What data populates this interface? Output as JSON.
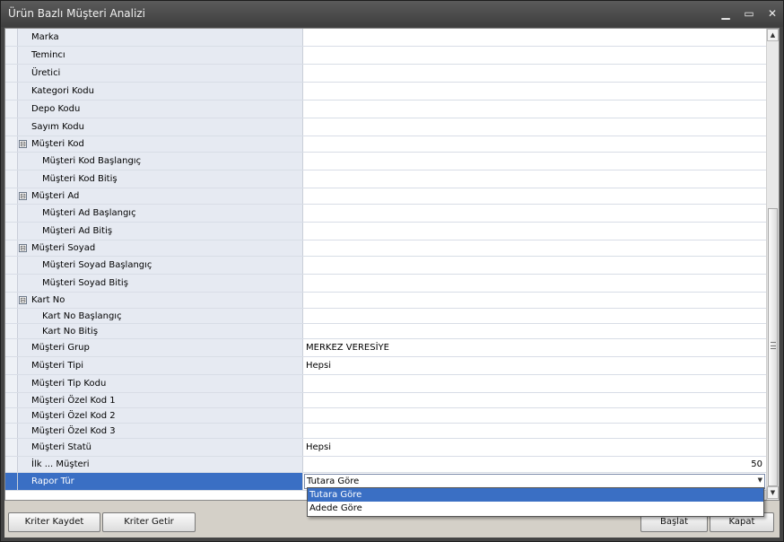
{
  "window": {
    "title": "Ürün Bazlı Müşteri Analizi",
    "minimize_glyph": "▁",
    "maximize_glyph": "▭",
    "close_glyph": "✕"
  },
  "rows": [
    {
      "label": "Marka",
      "value": "",
      "kind": "plain"
    },
    {
      "label": "Temincı",
      "value": "",
      "kind": "plain"
    },
    {
      "label": "Üretici",
      "value": "",
      "kind": "plain"
    },
    {
      "label": "Kategori Kodu",
      "value": "",
      "kind": "plain"
    },
    {
      "label": "Depo Kodu",
      "value": "",
      "kind": "plain"
    },
    {
      "label": "Sayım Kodu",
      "value": "",
      "kind": "plain"
    },
    {
      "label": "Müşteri Kod",
      "value": "",
      "kind": "group"
    },
    {
      "label": "Müşteri Kod Başlangıç",
      "value": "",
      "kind": "child"
    },
    {
      "label": "Müşteri Kod Bitiş",
      "value": "",
      "kind": "child"
    },
    {
      "label": "Müşteri Ad",
      "value": "",
      "kind": "group"
    },
    {
      "label": "Müşteri Ad Başlangıç",
      "value": "",
      "kind": "child"
    },
    {
      "label": "Müşteri Ad Bitiş",
      "value": "",
      "kind": "child"
    },
    {
      "label": "Müşteri Soyad",
      "value": "",
      "kind": "group"
    },
    {
      "label": "Müşteri Soyad Başlangıç",
      "value": "",
      "kind": "child"
    },
    {
      "label": "Müşteri Soyad Bitiş",
      "value": "",
      "kind": "child"
    },
    {
      "label": "Kart No",
      "value": "",
      "kind": "group"
    },
    {
      "label": "Kart No Başlangıç",
      "value": "",
      "kind": "child"
    },
    {
      "label": "Kart No Bitiş",
      "value": "",
      "kind": "child"
    },
    {
      "label": "Müşteri Grup",
      "value": "MERKEZ VERESİYE",
      "kind": "plain"
    },
    {
      "label": "Müşteri Tipi",
      "value": "Hepsi",
      "kind": "plain"
    },
    {
      "label": "Müşteri Tip Kodu",
      "value": "",
      "kind": "plain"
    },
    {
      "label": "Müşteri Özel Kod 1",
      "value": "",
      "kind": "plain"
    },
    {
      "label": "Müşteri Özel Kod 2",
      "value": "",
      "kind": "plain"
    },
    {
      "label": "Müşteri Özel Kod 3",
      "value": "",
      "kind": "plain"
    },
    {
      "label": "Müşteri Statü",
      "value": "Hepsi",
      "kind": "plain"
    },
    {
      "label": "İlk ... Müşteri",
      "value": "50",
      "kind": "number"
    },
    {
      "label": "Rapor Tür",
      "value": "Tutara Göre",
      "kind": "combo"
    }
  ],
  "dropdown": {
    "options": [
      "Tutara Göre",
      "Adede Göre"
    ],
    "selected_index": 0
  },
  "buttons": {
    "save_criteria": "Kriter Kaydet",
    "load_criteria": "Kriter Getir",
    "start": "Başlat",
    "close": "Kapat"
  },
  "icons": {
    "expand_glyph": "⊟",
    "scroll_up": "▲",
    "scroll_down": "▼",
    "combo_arrow": "▼"
  }
}
